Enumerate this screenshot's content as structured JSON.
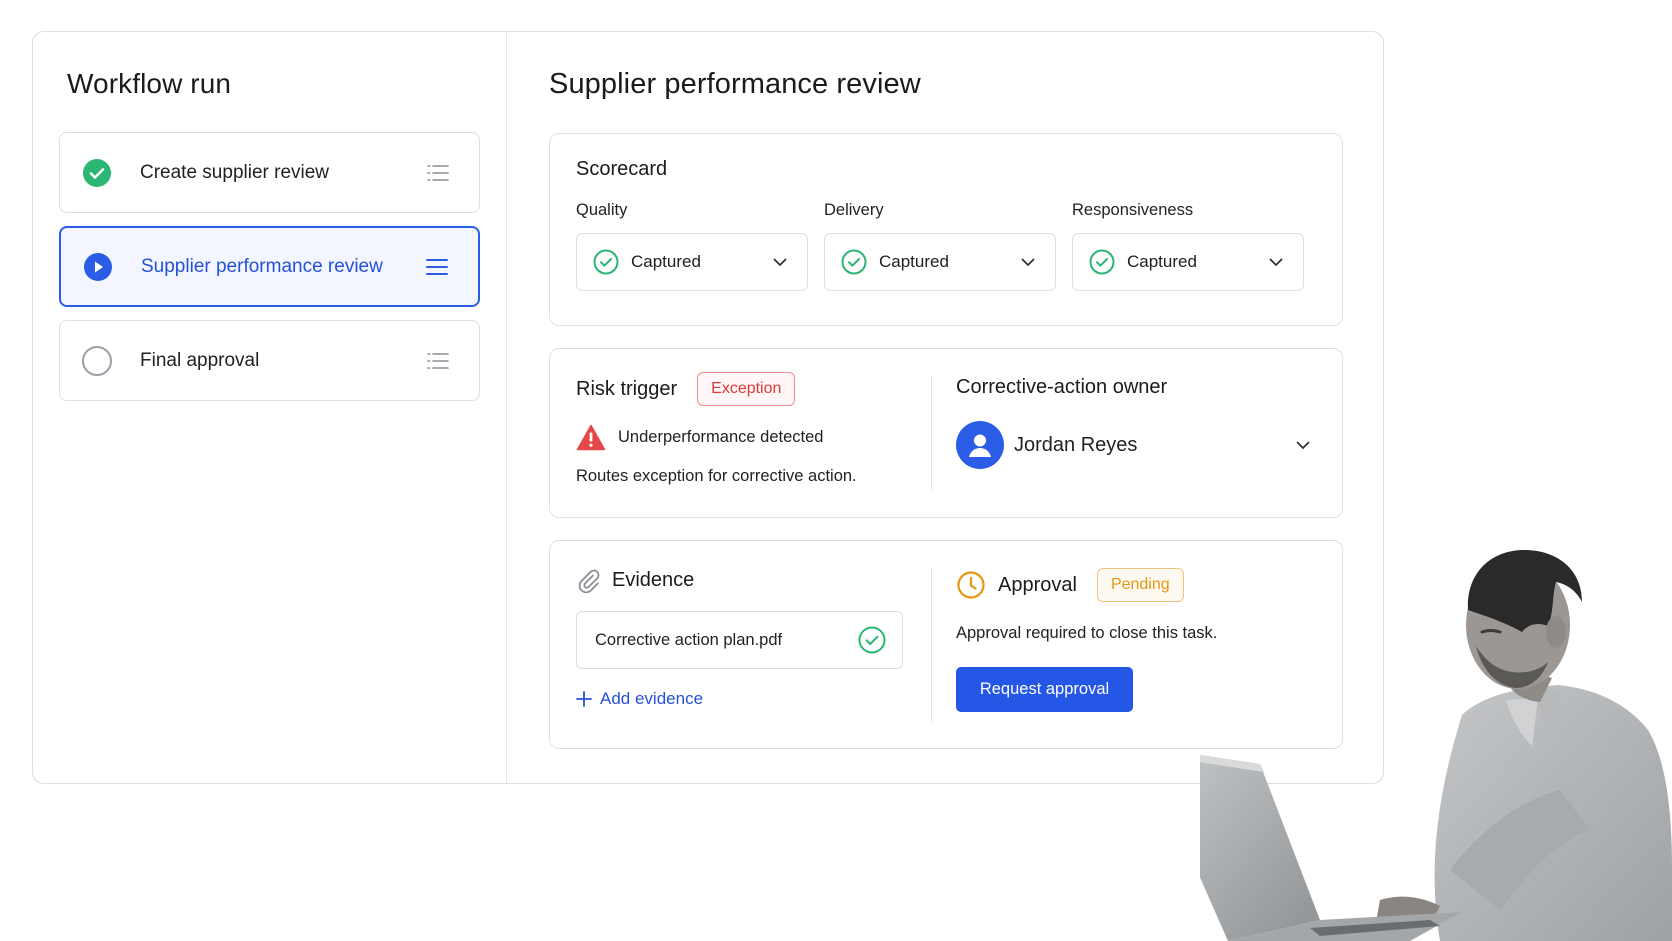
{
  "sidebar": {
    "title": "Workflow run",
    "steps": [
      {
        "label": "Create supplier review",
        "status": "completed"
      },
      {
        "label": "Supplier performance review",
        "status": "active"
      },
      {
        "label": "Final approval",
        "status": "pending"
      }
    ]
  },
  "main": {
    "title": "Supplier performance review",
    "scorecard": {
      "title": "Scorecard",
      "fields": [
        {
          "label": "Quality",
          "value": "Captured"
        },
        {
          "label": "Delivery",
          "value": "Captured"
        },
        {
          "label": "Responsiveness",
          "value": "Captured"
        }
      ]
    },
    "risk": {
      "title": "Risk trigger",
      "badge": "Exception",
      "alert": "Underperformance detected",
      "description": "Routes exception for corrective action."
    },
    "owner": {
      "title": "Corrective-action owner",
      "name": "Jordan Reyes"
    },
    "evidence": {
      "title": "Evidence",
      "file": "Corrective action plan.pdf",
      "add_label": "Add evidence"
    },
    "approval": {
      "title": "Approval",
      "badge": "Pending",
      "description": "Approval required to close this task.",
      "button": "Request approval"
    }
  },
  "colors": {
    "accent": "#2457e6",
    "success": "#2bb673",
    "danger": "#e0383a",
    "warning": "#e79512"
  }
}
